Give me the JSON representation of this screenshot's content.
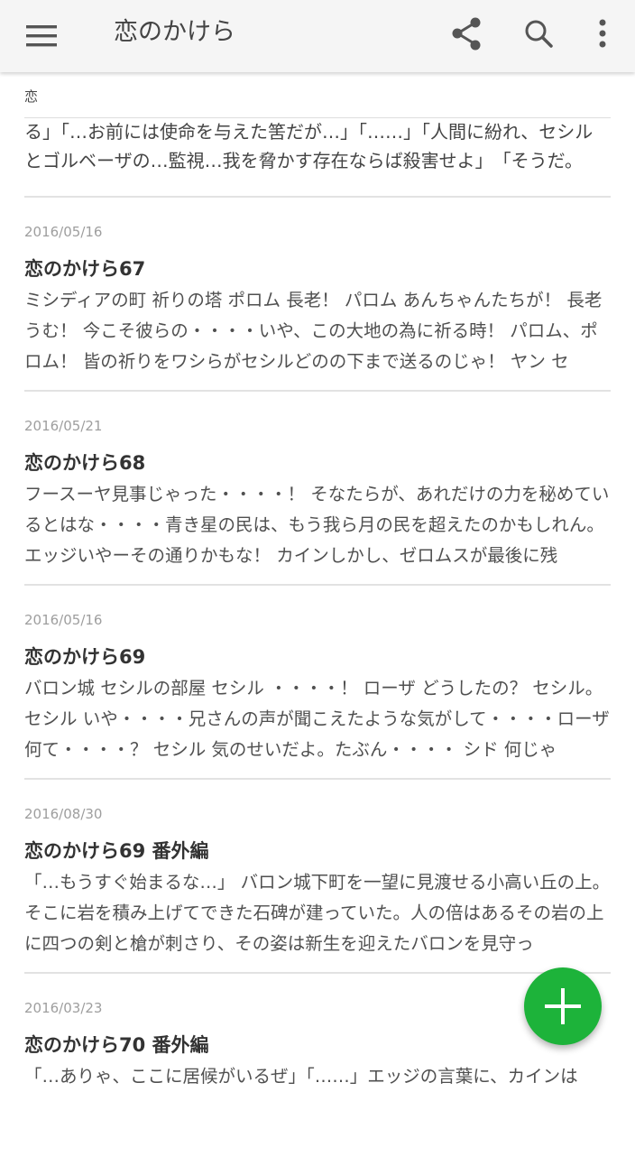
{
  "appbar": {
    "title": "恋のかけら",
    "icons": [
      "menu-icon",
      "share-icon",
      "search-icon",
      "more-vert-icon"
    ]
  },
  "partial_item": {
    "head": "恋",
    "excerpt": "る」「…お前には使命を与えた筈だが…」「……」「人間に紛れ、セシルとゴルベーザの…監視…我を脅かす存在ならば殺害せよ」　「そうだ。"
  },
  "items": [
    {
      "date": "2016/05/16",
      "title": "恋のかけら67",
      "excerpt": "ミシディアの町 祈りの塔 ポロム 長老！ パロム あんちゃんたちが！ 長老 うむ！ 今こそ彼らの・・・・いや、この大地の為に祈る時！ パロム、ポロム！ 皆の祈りをワシらがセシルどのの下まで送るのじゃ！ ヤン セ"
    },
    {
      "date": "2016/05/21",
      "title": "恋のかけら68",
      "excerpt": "フースーヤ見事じゃった・・・・！ そなたらが、あれだけの力を秘めているとはな・・・・青き星の民は、もう我ら月の民を超えたのかもしれん。 エッジいやーその通りかもな！ カインしかし、ゼロムスが最後に残"
    },
    {
      "date": "2016/05/16",
      "title": "恋のかけら69",
      "excerpt": "バロン城 セシルの部屋 セシル ・・・・！ ローザ どうしたの？ セシル。 セシル いや・・・・兄さんの声が聞こえたような気がして・・・・ローザ 何て・・・・？ セシル 気のせいだよ。たぶん・・・・ シド 何じゃ"
    },
    {
      "date": "2016/08/30",
      "title": "恋のかけら69 番外編",
      "excerpt": "「…もうすぐ始まるな…」 バロン城下町を一望に見渡せる小高い丘の上。そこに岩を積み上げてできた石碑が建っていた。人の倍はあるその岩の上に四つの剣と槍が刺さり、その姿は新生を迎えたバロンを見守っ"
    },
    {
      "date": "2016/03/23",
      "title": "恋のかけら70 番外編",
      "excerpt": "「…ありゃ、ここに居候がいるぜ」「……」エッジの言葉に、カインは"
    }
  ],
  "fab": {
    "icon": "plus-icon"
  },
  "colors": {
    "appbar_bg": "#f5f5f5",
    "fab": "#1db33a",
    "date": "#9e9e9e",
    "divider": "#e2e2e2"
  }
}
